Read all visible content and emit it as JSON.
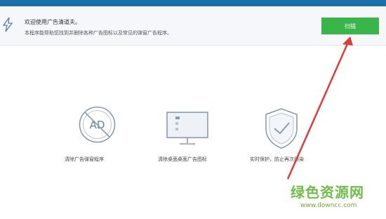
{
  "intro": {
    "title": "欢迎使用广告清道夫。",
    "description": "本程序能帮助您找到并删除各种广告图标以及常见的弹窗广告程序。"
  },
  "scan_button": {
    "label": "扫描"
  },
  "features": [
    {
      "icon": "ad-block-icon",
      "label": "清除广告弹窗程序"
    },
    {
      "icon": "monitor-icon",
      "label": "清除桌面桌面广告图标"
    },
    {
      "icon": "shield-check-icon",
      "label": "实时保护，防止再次感染"
    }
  ],
  "ad_icon_text": "AD",
  "watermark": {
    "site_name": "绿色资源网",
    "url": "www.downcc.com"
  },
  "colors": {
    "header": "#1c6fa8",
    "accent": "#3ab54a",
    "arrow": "#e03a3a",
    "icon": "#8a9bb0"
  }
}
